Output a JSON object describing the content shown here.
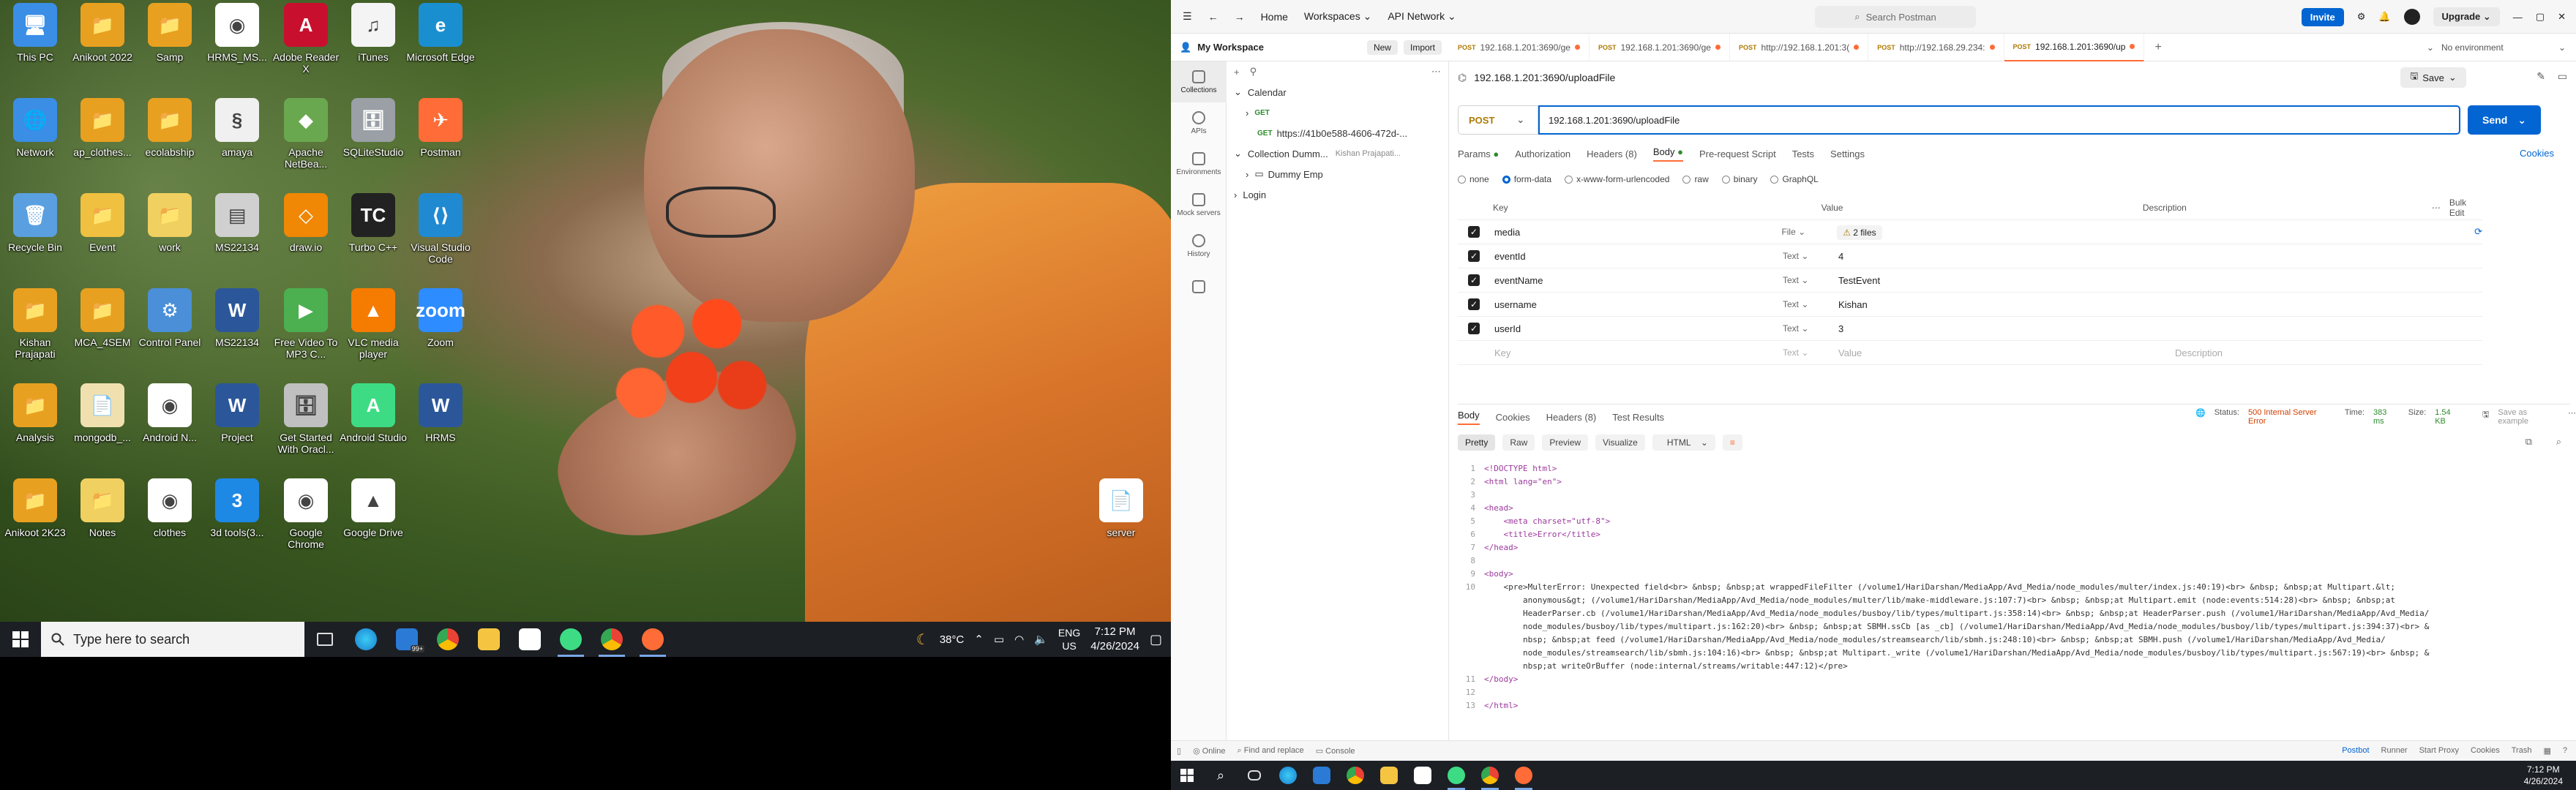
{
  "desktop": {
    "icons": [
      {
        "label": "This PC",
        "color": "#3a8ee6",
        "glyph": "🖥"
      },
      {
        "label": "Anikoot 2022",
        "color": "#e8a020",
        "glyph": "📁"
      },
      {
        "label": "Samp",
        "color": "#e8a020",
        "glyph": "📁"
      },
      {
        "label": "HRMS_MS...",
        "color": "#ffffff",
        "glyph": "◉"
      },
      {
        "label": "Adobe Reader X",
        "color": "#c8102e",
        "glyph": "A"
      },
      {
        "label": "iTunes",
        "color": "#f4f4f4",
        "glyph": "♫"
      },
      {
        "label": "Microsoft Edge",
        "color": "#1a8fd0",
        "glyph": "e"
      },
      {
        "label": "Network",
        "color": "#3a8ee6",
        "glyph": "🌐"
      },
      {
        "label": "ap_clothes...",
        "color": "#e8a020",
        "glyph": "📁"
      },
      {
        "label": "ecolabship",
        "color": "#e8a020",
        "glyph": "📁"
      },
      {
        "label": "amaya",
        "color": "#f0f0f0",
        "glyph": "§"
      },
      {
        "label": "Apache NetBea...",
        "color": "#6aa84f",
        "glyph": "◆"
      },
      {
        "label": "SQLiteStudio",
        "color": "#9aa0a6",
        "glyph": "🗄"
      },
      {
        "label": "Postman",
        "color": "#ff6c37",
        "glyph": "✈"
      },
      {
        "label": "Recycle Bin",
        "color": "#5aa0e0",
        "glyph": "🗑"
      },
      {
        "label": "Event",
        "color": "#f0c040",
        "glyph": "📁"
      },
      {
        "label": "work",
        "color": "#f0d060",
        "glyph": "📁"
      },
      {
        "label": "MS22134",
        "color": "#d0d0d0",
        "glyph": "▤"
      },
      {
        "label": "draw.io",
        "color": "#f08705",
        "glyph": "◇"
      },
      {
        "label": "Turbo C++",
        "color": "#222222",
        "glyph": "TC"
      },
      {
        "label": "Visual Studio Code",
        "color": "#1f8ad2",
        "glyph": "⟨⟩"
      },
      {
        "label": "Kishan Prajapati",
        "color": "#e8a020",
        "glyph": "📁"
      },
      {
        "label": "MCA_4SEM",
        "color": "#e8a020",
        "glyph": "📁"
      },
      {
        "label": "Control Panel",
        "color": "#4a8fd8",
        "glyph": "⚙"
      },
      {
        "label": "MS22134",
        "color": "#2b579a",
        "glyph": "W"
      },
      {
        "label": "Free Video To MP3 C...",
        "color": "#4caf50",
        "glyph": "▶"
      },
      {
        "label": "VLC media player",
        "color": "#f57c00",
        "glyph": "▲"
      },
      {
        "label": "Zoom",
        "color": "#2d8cff",
        "glyph": "zoom"
      },
      {
        "label": "Analysis",
        "color": "#e8a020",
        "glyph": "📁"
      },
      {
        "label": "mongodb_...",
        "color": "#f0e0b0",
        "glyph": "📄"
      },
      {
        "label": "Android N...",
        "color": "#ffffff",
        "glyph": "◉"
      },
      {
        "label": "Project",
        "color": "#2b579a",
        "glyph": "W"
      },
      {
        "label": "Get Started With Oracl...",
        "color": "#c0c0c0",
        "glyph": "🗄"
      },
      {
        "label": "Android Studio",
        "color": "#3ddc84",
        "glyph": "A"
      },
      {
        "label": "HRMS",
        "color": "#2b579a",
        "glyph": "W"
      },
      {
        "label": "Anikoot 2K23",
        "color": "#e8a020",
        "glyph": "📁"
      },
      {
        "label": "Notes",
        "color": "#f0d060",
        "glyph": "📁"
      },
      {
        "label": "clothes",
        "color": "#ffffff",
        "glyph": "◉"
      },
      {
        "label": "3d tools(3...",
        "color": "#1e88e5",
        "glyph": "3"
      },
      {
        "label": "Google Chrome",
        "color": "#ffffff",
        "glyph": "◉"
      },
      {
        "label": "Google Drive",
        "color": "#ffffff",
        "glyph": "▲"
      },
      {
        "label": "server",
        "color": "#ffffff",
        "glyph": "📄"
      }
    ]
  },
  "taskbar_left": {
    "search_placeholder": "Type here to search",
    "weather": "38°C",
    "lang": "ENG",
    "region": "US",
    "time": "7:12 PM",
    "date": "4/26/2024",
    "mail_badge": "99+"
  },
  "postman": {
    "nav": {
      "home": "Home",
      "workspaces": "Workspaces",
      "api_network": "API Network"
    },
    "search_placeholder": "Search Postman",
    "invite": "Invite",
    "upgrade": "Upgrade",
    "workspace_name": "My Workspace",
    "new_btn": "New",
    "import_btn": "Import",
    "rail": [
      "Collections",
      "APIs",
      "Environments",
      "Mock servers",
      "History",
      ""
    ],
    "tree": {
      "calendar": "Calendar",
      "get1": "GET",
      "get2_url": "https://41b0e588-4606-472d-...",
      "collection_dummy": "Collection Dumm...",
      "owner": "Kishan Prajapati...",
      "dummy_emp": "Dummy Emp",
      "login": "Login"
    },
    "tabs": [
      {
        "method": "POST",
        "label": "192.168.1.201:3690/ge"
      },
      {
        "method": "POST",
        "label": "192.168.1.201:3690/ge"
      },
      {
        "method": "POST",
        "label": "http://192.168.1.201:3("
      },
      {
        "method": "POST",
        "label": "http://192.168.29.234:"
      },
      {
        "method": "POST",
        "label": "192.168.1.201:3690/up"
      }
    ],
    "environment": "No environment",
    "request_title": "192.168.1.201:3690/uploadFile",
    "save": "Save",
    "method": "POST",
    "url": "192.168.1.201:3690/uploadFile",
    "send": "Send",
    "req_tabs": {
      "params": "Params",
      "authorization": "Authorization",
      "headers": "Headers (8)",
      "body": "Body",
      "prerequest": "Pre-request Script",
      "tests": "Tests",
      "settings": "Settings"
    },
    "cookies": "Cookies",
    "body_opts": {
      "none": "none",
      "form_data": "form-data",
      "urlencoded": "x-www-form-urlencoded",
      "raw": "raw",
      "binary": "binary",
      "graphql": "GraphQL"
    },
    "kv_head": {
      "key": "Key",
      "value": "Value",
      "description": "Description",
      "bulk": "Bulk Edit"
    },
    "kv_rows": [
      {
        "key": "media",
        "type": "File",
        "value": "2 files"
      },
      {
        "key": "eventId",
        "type": "Text",
        "value": "4"
      },
      {
        "key": "eventName",
        "type": "Text",
        "value": "TestEvent"
      },
      {
        "key": "username",
        "type": "Text",
        "value": "Kishan"
      },
      {
        "key": "userId",
        "type": "Text",
        "value": "3"
      }
    ],
    "kv_placeholder": {
      "key": "Key",
      "type": "Text",
      "value": "Value",
      "description": "Description"
    },
    "resp_tabs": {
      "body": "Body",
      "cookies": "Cookies",
      "headers": "Headers (8)",
      "test_results": "Test Results"
    },
    "resp_status": {
      "status_label": "Status:",
      "status": "500 Internal Server Error",
      "time_label": "Time:",
      "time": "383 ms",
      "size_label": "Size:",
      "size": "1.54 KB",
      "save_example": "Save as example"
    },
    "resp_toolbar": {
      "pretty": "Pretty",
      "raw": "Raw",
      "preview": "Preview",
      "visualize": "Visualize",
      "format": "HTML"
    },
    "code_lines": [
      {
        "n": "1",
        "t": "<!DOCTYPE html>"
      },
      {
        "n": "2",
        "t": "<html lang=\"en\">"
      },
      {
        "n": "3",
        "t": ""
      },
      {
        "n": "4",
        "t": "<head>"
      },
      {
        "n": "5",
        "t": "    <meta charset=\"utf-8\">"
      },
      {
        "n": "6",
        "t": "    <title>Error</title>"
      },
      {
        "n": "7",
        "t": "</head>"
      },
      {
        "n": "8",
        "t": ""
      },
      {
        "n": "9",
        "t": "<body>"
      },
      {
        "n": "10",
        "t": "    <pre>MulterError: Unexpected field<br> &nbsp; &nbsp;at wrappedFileFilter (/volume1/HariDarshan/MediaApp/Avd_Media/node_modules/multer/index.js:40:19)<br> &nbsp; &nbsp;at Multipart.&lt;\n        anonymous&gt; (/volume1/HariDarshan/MediaApp/Avd_Media/node_modules/multer/lib/make-middleware.js:107:7)<br> &nbsp; &nbsp;at Multipart.emit (node:events:514:28)<br> &nbsp; &nbsp;at\n        HeaderParser.cb (/volume1/HariDarshan/MediaApp/Avd_Media/node_modules/busboy/lib/types/multipart.js:358:14)<br> &nbsp; &nbsp;at HeaderParser.push (/volume1/HariDarshan/MediaApp/Avd_Media/\n        node_modules/busboy/lib/types/multipart.js:162:20)<br> &nbsp; &nbsp;at SBMH.ssCb [as _cb] (/volume1/HariDarshan/MediaApp/Avd_Media/node_modules/busboy/lib/types/multipart.js:394:37)<br> &\n        nbsp; &nbsp;at feed (/volume1/HariDarshan/MediaApp/Avd_Media/node_modules/streamsearch/lib/sbmh.js:248:10)<br> &nbsp; &nbsp;at SBMH.push (/volume1/HariDarshan/MediaApp/Avd_Media/\n        node_modules/streamsearch/lib/sbmh.js:104:16)<br> &nbsp; &nbsp;at Multipart._write (/volume1/HariDarshan/MediaApp/Avd_Media/node_modules/busboy/lib/types/multipart.js:567:19)<br> &nbsp; &\n        nbsp;at writeOrBuffer (node:internal/streams/writable:447:12)</pre>"
      },
      {
        "n": "11",
        "t": "</body>"
      },
      {
        "n": "12",
        "t": ""
      },
      {
        "n": "13",
        "t": "</html>"
      }
    ],
    "statusbar": {
      "online": "Online",
      "find": "Find and replace",
      "console": "Console",
      "postbot": "Postbot",
      "runner": "Runner",
      "start_proxy": "Start Proxy",
      "cookies": "Cookies",
      "trash": "Trash"
    }
  },
  "taskbar_right": {
    "time": "7:12 PM",
    "date": "4/26/2024"
  }
}
